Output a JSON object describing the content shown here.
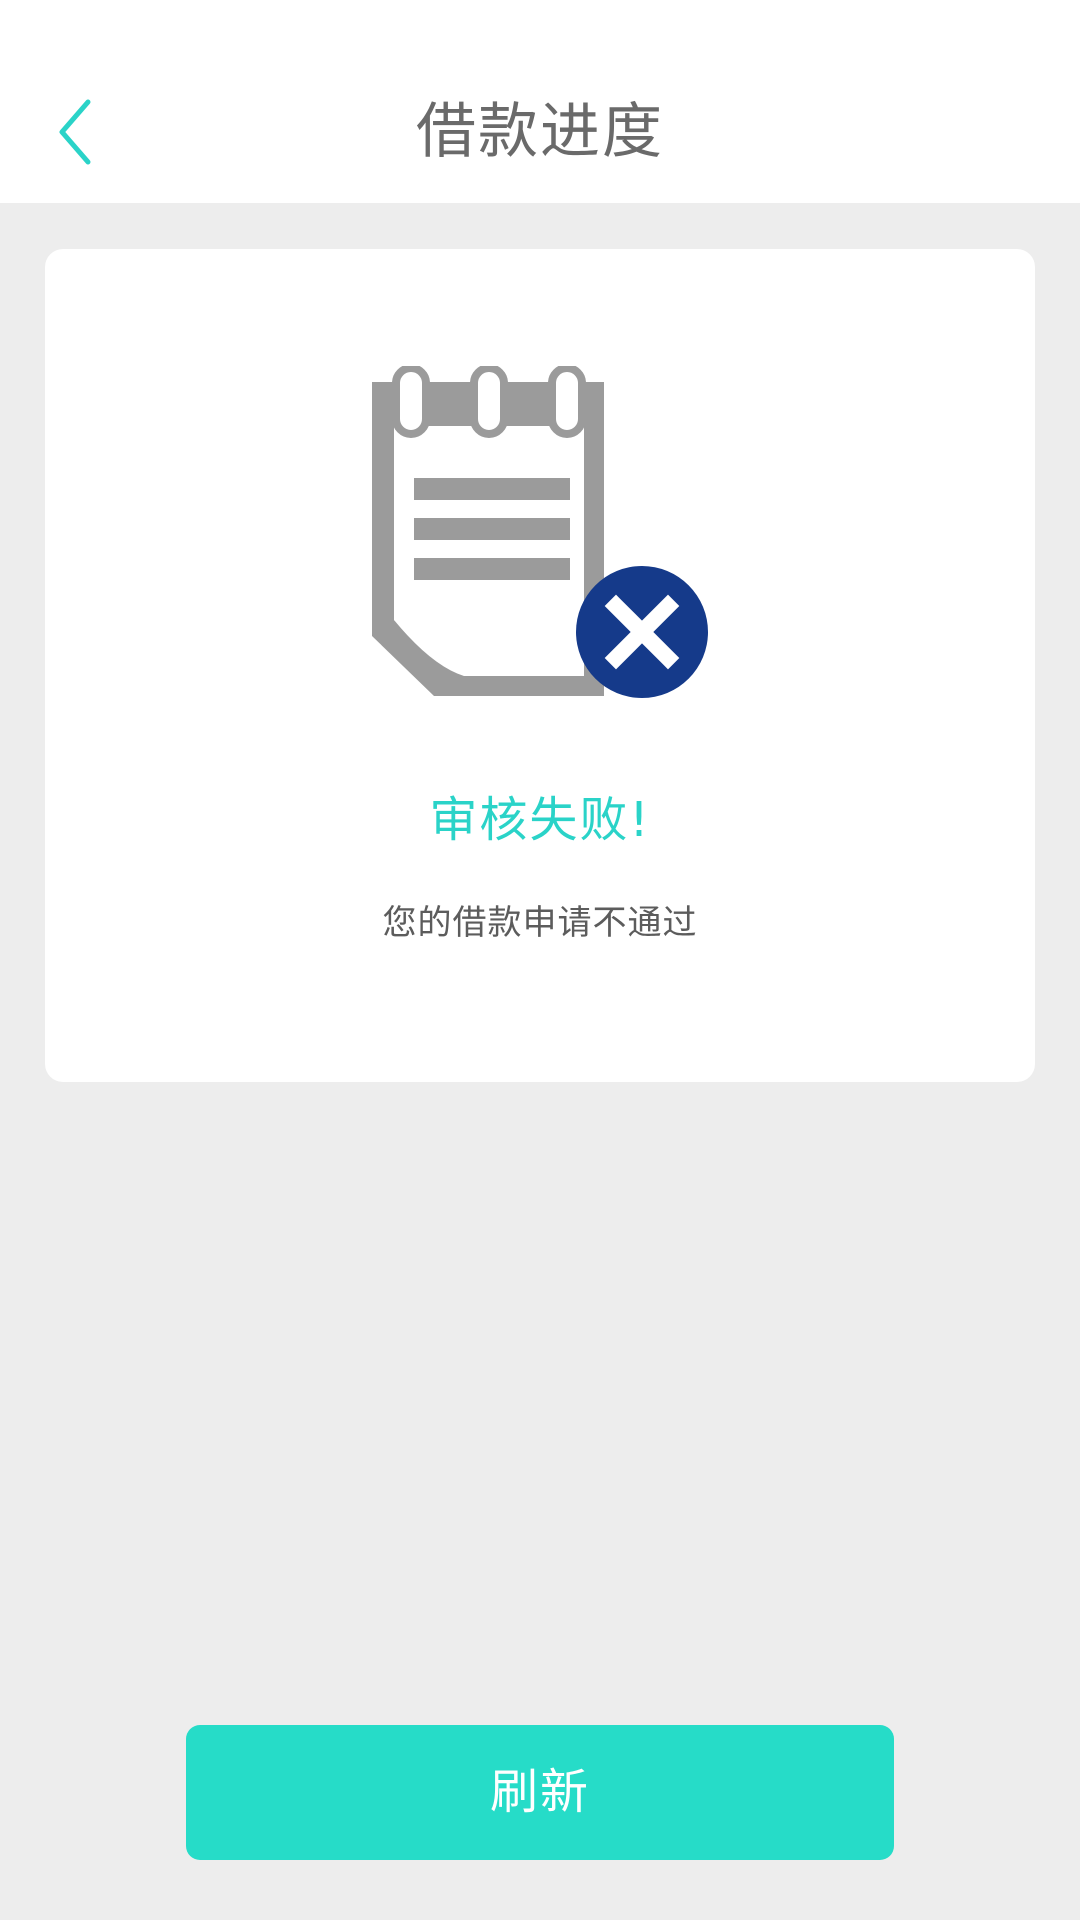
{
  "header": {
    "title": "借款进度",
    "back_icon": "chevron-left-icon"
  },
  "status": {
    "icon": "notepad-rejected-icon",
    "title": "审核失败!",
    "description": "您的借款申请不通过"
  },
  "actions": {
    "refresh_label": "刷新"
  },
  "colors": {
    "accent": "#26dcc8",
    "accent_text": "#2ad3c8",
    "icon_gray": "#9b9b9b",
    "reject_badge": "#153a8a",
    "background": "#ededed",
    "card": "#ffffff"
  }
}
